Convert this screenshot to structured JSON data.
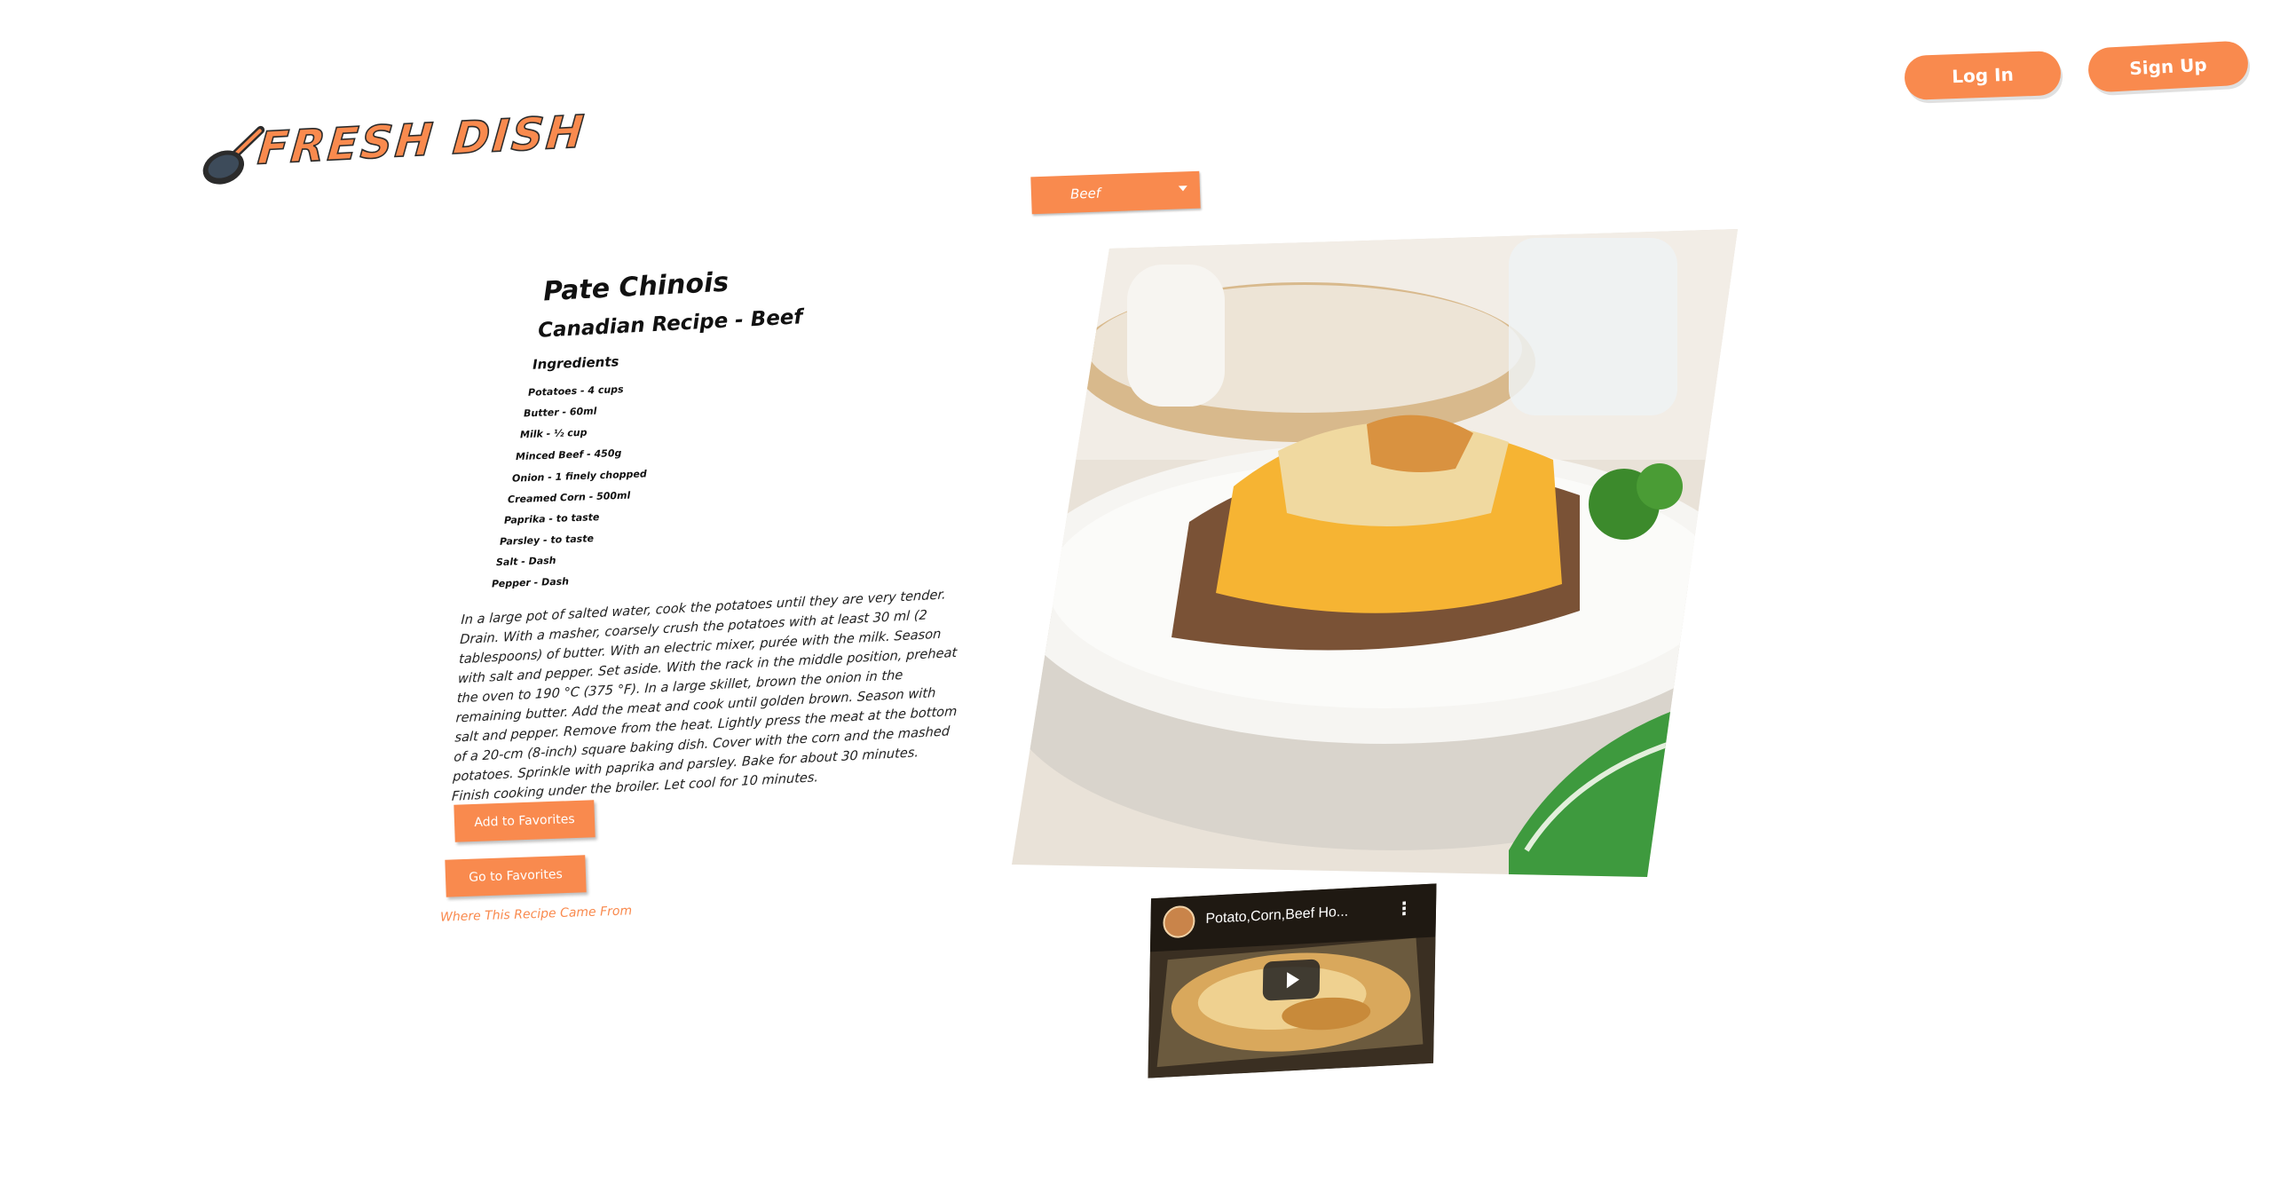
{
  "header": {
    "login_label": "Log In",
    "signup_label": "Sign Up",
    "logo_text": "FRESH DISH"
  },
  "filter": {
    "selected_category": "Beef"
  },
  "recipe": {
    "title": "Pate Chinois",
    "subtitle": "Canadian Recipe - Beef",
    "ingredients_heading": "Ingredients",
    "ingredients": [
      "Potatoes - 4 cups",
      "Butter - 60ml",
      "Milk - ½ cup",
      "Minced Beef - 450g",
      "Onion - 1 finely chopped",
      "Creamed Corn - 500ml",
      "Paprika - to taste",
      "Parsley - to taste",
      "Salt - Dash",
      "Pepper - Dash"
    ],
    "instructions": "In a large pot of salted water, cook the potatoes until they are very tender. Drain. With a masher, coarsely crush the potatoes with at least 30 ml (2 tablespoons) of butter. With an electric mixer, purée with the milk. Season with salt and pepper. Set aside. With the rack in the middle position, preheat the oven to 190 °C (375 °F). In a large skillet, brown the onion in the remaining butter. Add the meat and cook until golden brown. Season with salt and pepper. Remove from the heat. Lightly press the meat at the bottom of a 20-cm (8-inch) square baking dish. Cover with the corn and the mashed potatoes. Sprinkle with paprika and parsley. Bake for about 30 minutes. Finish cooking under the broiler. Let cool for 10 minutes.",
    "add_favorites_label": "Add to Favorites",
    "go_favorites_label": "Go to Favorites",
    "source_link_label": "Where This Recipe Came From"
  },
  "video": {
    "title": "Potato,Corn,Beef Ho..."
  },
  "colors": {
    "accent": "#f98a4e"
  }
}
